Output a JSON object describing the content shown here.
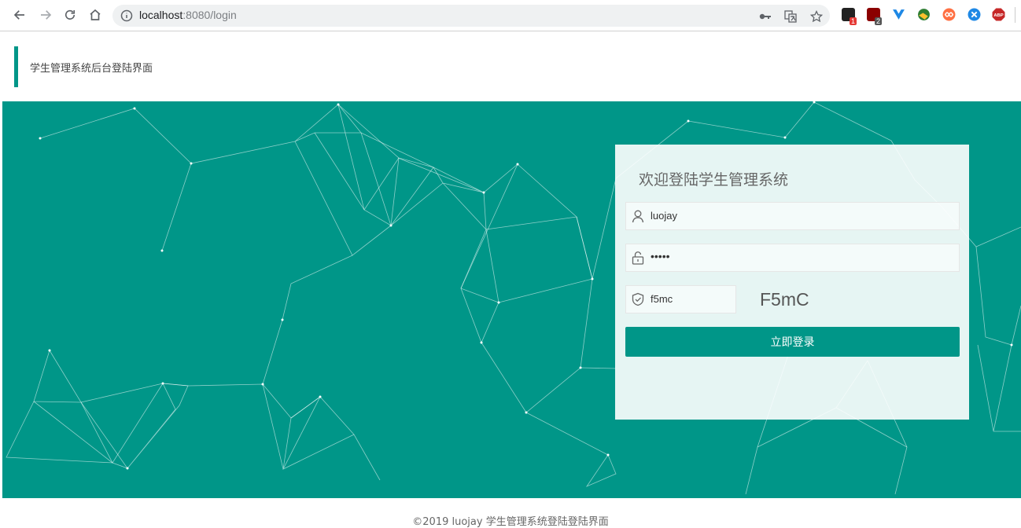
{
  "browser": {
    "url_host": "localhost",
    "url_path": ":8080/login",
    "icons": [
      "back-icon",
      "forward-icon",
      "reload-icon",
      "home-icon",
      "info-icon",
      "key-icon",
      "translate-icon",
      "star-icon"
    ],
    "extensions": [
      {
        "name": "ext-ghost-icon",
        "badge": "1",
        "color": "#222222",
        "badge_color": "#e53935"
      },
      {
        "name": "ext-ublock-icon",
        "badge": "2",
        "color": "#8b0000",
        "badge_color": "#555555"
      },
      {
        "name": "ext-vue-icon",
        "badge": "",
        "color": "#1e88e5",
        "badge_color": ""
      },
      {
        "name": "ext-globe-icon",
        "badge": "",
        "color": "#2e7d32",
        "badge_color": ""
      },
      {
        "name": "ext-infinity-icon",
        "badge": "",
        "color": "#ff7043",
        "badge_color": ""
      },
      {
        "name": "ext-blue-circle-icon",
        "badge": "",
        "color": "#1e88e5",
        "badge_color": ""
      },
      {
        "name": "ext-abp-icon",
        "badge": "",
        "color": "#c62828",
        "badge_color": ""
      }
    ]
  },
  "header": {
    "title": "学生管理系统后台登陆界面",
    "accent": "#009688"
  },
  "login": {
    "title": "欢迎登陆学生管理系统",
    "username": "luojay",
    "password_mask": "•••••",
    "captcha_input": "f5mc",
    "captcha_image_text": "F5mC",
    "submit_label": "立即登录"
  },
  "footer": {
    "text": "©2019 luojay 学生管理系统登陆登陆界面"
  }
}
